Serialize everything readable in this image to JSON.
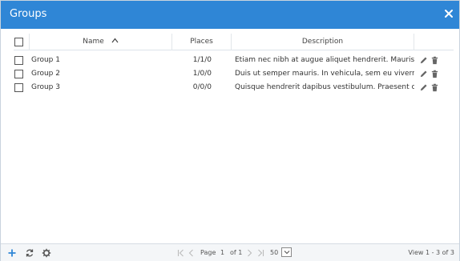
{
  "window": {
    "title": "Groups"
  },
  "columns": {
    "name": "Name",
    "places": "Places",
    "description": "Description"
  },
  "rows": [
    {
      "name": "Group 1",
      "places": "1/1/0",
      "description": "Etiam nec nibh at augue aliquet hendrerit. Mauris vulputate"
    },
    {
      "name": "Group 2",
      "places": "1/0/0",
      "description": "Duis ut semper mauris. In vehicula, sem eu viverra blandit"
    },
    {
      "name": "Group 3",
      "places": "0/0/0",
      "description": "Quisque hendrerit dapibus vestibulum. Praesent cursus quam"
    }
  ],
  "pager": {
    "page_label": "Page",
    "page": "1",
    "of_label": "of 1",
    "page_size": "50"
  },
  "view": "View 1 - 3 of 3",
  "colors": {
    "accent": "#2f86d6",
    "icon": "#555555"
  },
  "icons": {
    "close": "close-icon",
    "sort": "chevron-up-icon",
    "edit": "pencil-icon",
    "delete": "trash-icon",
    "add": "plus-icon",
    "refresh": "refresh-icon",
    "settings": "gear-icon",
    "first": "first-page-icon",
    "prev": "prev-page-icon",
    "next": "next-page-icon",
    "last": "last-page-icon",
    "dropdown": "chevron-down-icon"
  }
}
